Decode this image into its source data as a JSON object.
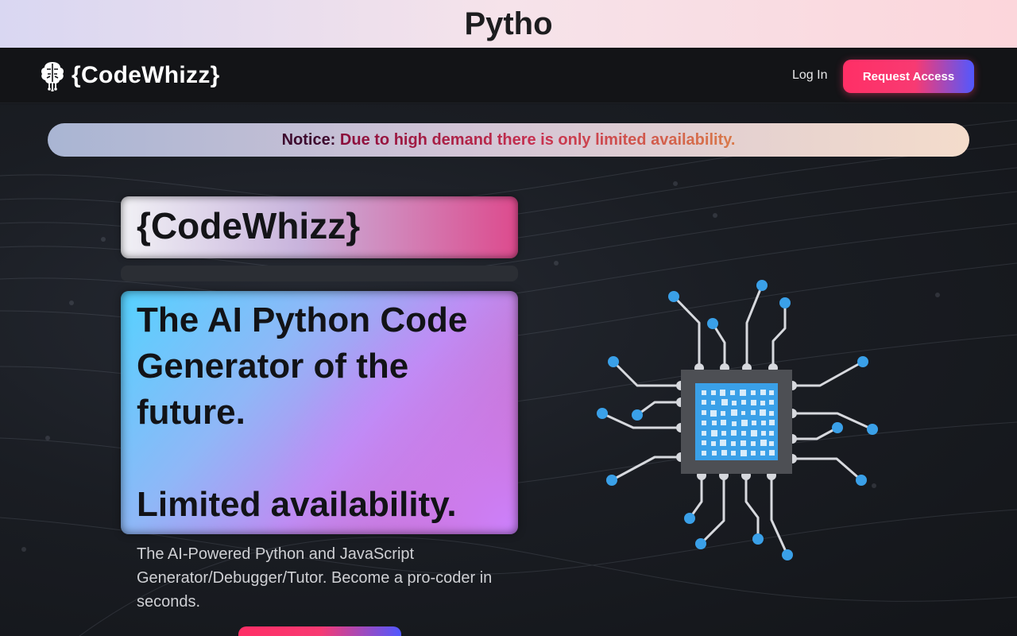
{
  "top_banner": {
    "title": "Pytho"
  },
  "navbar": {
    "brand": "{CodeWhizz}",
    "login_label": "Log In",
    "request_label": "Request Access"
  },
  "notice": {
    "label": "Notice:",
    "message": "Due to high demand there is only limited availability."
  },
  "hero": {
    "title_card": "{CodeWhizz}",
    "headline": "The AI Python Code Generator of the future.",
    "limited": "Limited availability.",
    "description": "The AI-Powered Python and JavaScript Generator/Debugger/Tutor. Become a pro-coder in seconds."
  },
  "icons": {
    "logo": "brain-circuit-icon",
    "illustration": "cpu-chip-icon"
  },
  "colors": {
    "accent_pink": "#ff2f66",
    "accent_blue": "#5158ff",
    "chip_blue": "#3aa0e8",
    "dark_bg": "#131417"
  }
}
